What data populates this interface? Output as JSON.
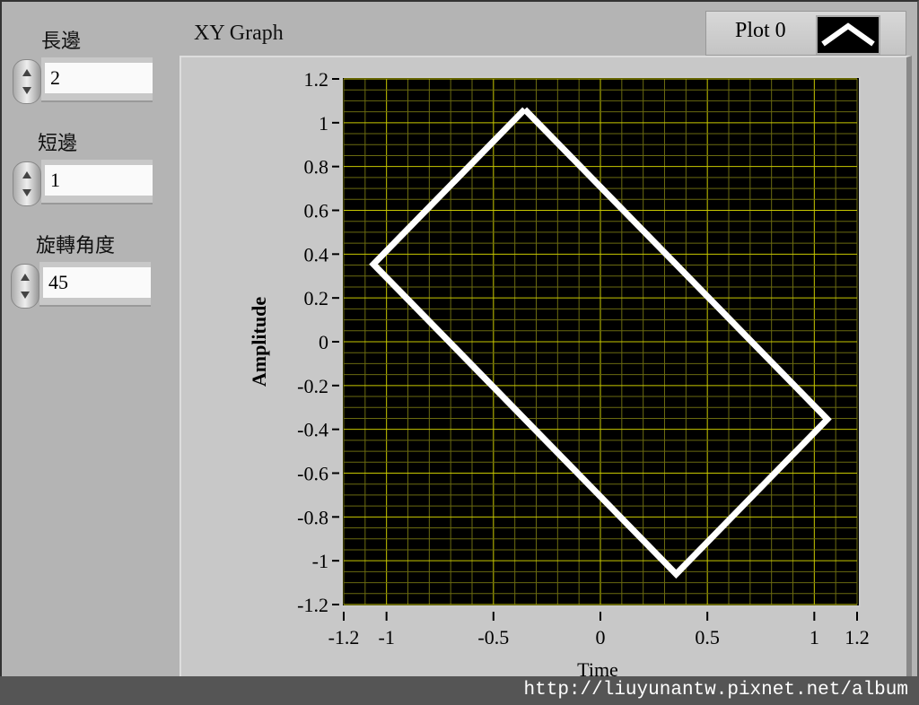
{
  "controls": [
    {
      "label": "長邊",
      "value": "2"
    },
    {
      "label": "短邊",
      "value": "1"
    },
    {
      "label": "旋轉角度",
      "value": "45"
    }
  ],
  "graph": {
    "title": "XY Graph",
    "legend": "Plot 0"
  },
  "watermark": "http://liuyunantw.pixnet.net/album",
  "chart_data": {
    "type": "line",
    "title": "XY Graph",
    "xlabel": "Time",
    "ylabel": "Amplitude",
    "xlim": [
      -1.2,
      1.2
    ],
    "ylim": [
      -1.2,
      1.2
    ],
    "xticks": [
      "-1.2",
      "-1",
      "-0.5",
      "0",
      "0.5",
      "1",
      "1.2"
    ],
    "xtick_values": [
      -1.2,
      -1,
      -0.5,
      0,
      0.5,
      1,
      1.2
    ],
    "yticks": [
      "1.2",
      "1",
      "0.8",
      "0.6",
      "0.4",
      "0.2",
      "0",
      "-0.2",
      "-0.4",
      "-0.6",
      "-0.8",
      "-1",
      "-1.2"
    ],
    "ytick_values": [
      1.2,
      1,
      0.8,
      0.6,
      0.4,
      0.2,
      0,
      -0.2,
      -0.4,
      -0.6,
      -0.8,
      -1,
      -1.2
    ],
    "grid": true,
    "series": [
      {
        "name": "Plot 0",
        "color": "#ffffff",
        "x": [
          -0.354,
          1.061,
          0.354,
          -1.061,
          -0.354
        ],
        "y": [
          1.061,
          -0.354,
          -1.061,
          0.354,
          1.061
        ]
      }
    ]
  }
}
